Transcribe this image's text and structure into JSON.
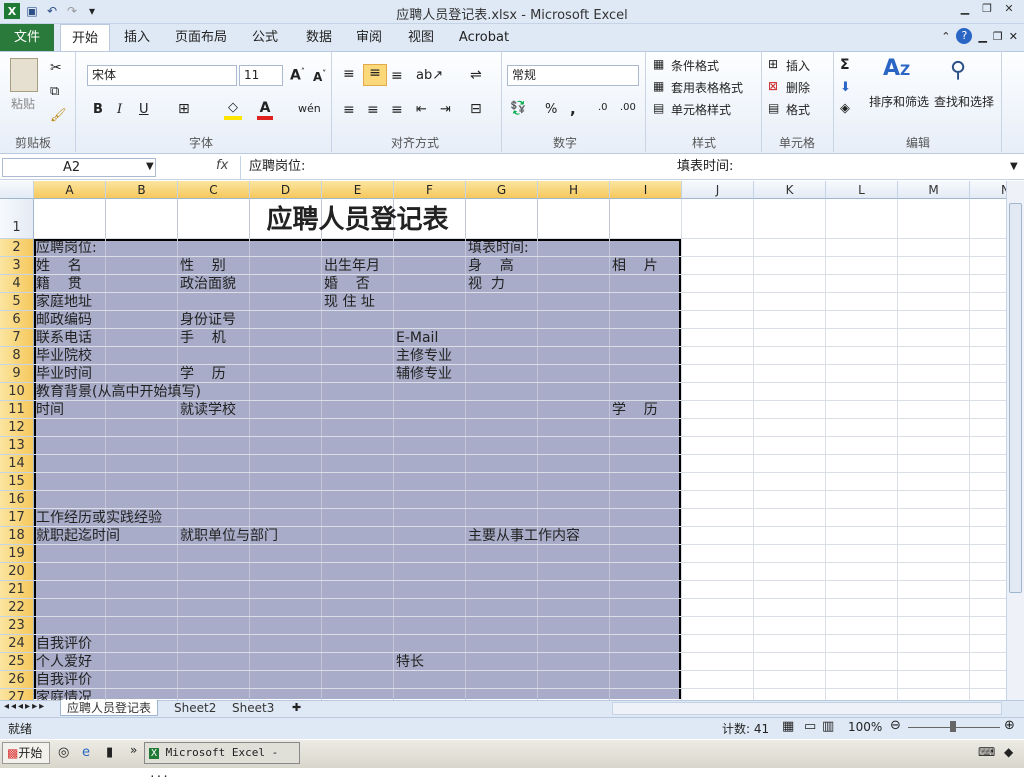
{
  "window": {
    "title": "应聘人员登记表.xlsx - Microsoft Excel"
  },
  "ribbon": {
    "file_tab": "文件",
    "tabs": [
      "开始",
      "插入",
      "页面布局",
      "公式",
      "数据",
      "审阅",
      "视图",
      "Acrobat"
    ],
    "clipboard": {
      "paste": "粘贴",
      "label": "剪贴板"
    },
    "font": {
      "name": "宋体",
      "size": "11",
      "label": "字体"
    },
    "align": {
      "label": "对齐方式"
    },
    "number": {
      "format": "常规",
      "label": "数字"
    },
    "styles": {
      "cond": "条件格式",
      "table": "套用表格格式",
      "cell": "单元格样式",
      "label": "样式"
    },
    "cells": {
      "insert": "插入",
      "delete": "删除",
      "format": "格式",
      "label": "单元格"
    },
    "edit": {
      "sort": "排序和筛选",
      "find": "查找和选择",
      "label": "编辑"
    }
  },
  "formula_bar": {
    "name_box": "A2",
    "content": "应聘岗位:",
    "content2": "填表时间:"
  },
  "columns": [
    "A",
    "B",
    "C",
    "D",
    "E",
    "F",
    "G",
    "H",
    "I",
    "J",
    "K",
    "L",
    "M",
    "N"
  ],
  "rows": [
    "1",
    "2",
    "3",
    "4",
    "5",
    "6",
    "7",
    "8",
    "9",
    "10",
    "11",
    "12",
    "13",
    "14",
    "15",
    "16",
    "17",
    "18",
    "19",
    "20",
    "21",
    "22",
    "23",
    "24",
    "25",
    "26",
    "27"
  ],
  "sheet": {
    "title": "应聘人员登记表",
    "cells": [
      {
        "r": 2,
        "c": "A",
        "t": "应聘岗位:"
      },
      {
        "r": 2,
        "c": "G",
        "t": "填表时间:"
      },
      {
        "r": 3,
        "c": "A",
        "t": "姓    名"
      },
      {
        "r": 3,
        "c": "C",
        "t": "性    别"
      },
      {
        "r": 3,
        "c": "E",
        "t": "出生年月"
      },
      {
        "r": 3,
        "c": "G",
        "t": "身    高"
      },
      {
        "r": 3,
        "c": "I",
        "t": "相    片"
      },
      {
        "r": 4,
        "c": "A",
        "t": "籍    贯"
      },
      {
        "r": 4,
        "c": "C",
        "t": "政治面貌"
      },
      {
        "r": 4,
        "c": "E",
        "t": "婚    否"
      },
      {
        "r": 4,
        "c": "G",
        "t": "视  力"
      },
      {
        "r": 5,
        "c": "A",
        "t": "家庭地址"
      },
      {
        "r": 5,
        "c": "E",
        "t": "现 住 址"
      },
      {
        "r": 6,
        "c": "A",
        "t": "邮政编码"
      },
      {
        "r": 6,
        "c": "C",
        "t": "身份证号"
      },
      {
        "r": 7,
        "c": "A",
        "t": "联系电话"
      },
      {
        "r": 7,
        "c": "C",
        "t": "手    机"
      },
      {
        "r": 7,
        "c": "F",
        "t": "E-Mail"
      },
      {
        "r": 8,
        "c": "A",
        "t": "毕业院校"
      },
      {
        "r": 8,
        "c": "F",
        "t": "主修专业"
      },
      {
        "r": 9,
        "c": "A",
        "t": "毕业时间"
      },
      {
        "r": 9,
        "c": "C",
        "t": "学    历"
      },
      {
        "r": 9,
        "c": "F",
        "t": "辅修专业"
      },
      {
        "r": 10,
        "c": "A",
        "t": "教育背景(从高中开始填写)"
      },
      {
        "r": 11,
        "c": "A",
        "t": "时间"
      },
      {
        "r": 11,
        "c": "C",
        "t": "就读学校"
      },
      {
        "r": 11,
        "c": "I",
        "t": "学    历"
      },
      {
        "r": 17,
        "c": "A",
        "t": "工作经历或实践经验"
      },
      {
        "r": 18,
        "c": "A",
        "t": "就职起迄时间"
      },
      {
        "r": 18,
        "c": "C",
        "t": "就职单位与部门"
      },
      {
        "r": 18,
        "c": "G",
        "t": "主要从事工作内容"
      },
      {
        "r": 24,
        "c": "A",
        "t": "自我评价"
      },
      {
        "r": 25,
        "c": "A",
        "t": "个人爱好"
      },
      {
        "r": 25,
        "c": "F",
        "t": "特长"
      },
      {
        "r": 26,
        "c": "A",
        "t": "自我评价"
      },
      {
        "r": 27,
        "c": "A",
        "t": "家庭情况"
      }
    ]
  },
  "sheet_tabs": [
    "应聘人员登记表",
    "Sheet2",
    "Sheet3"
  ],
  "status": {
    "ready": "就绪",
    "count": "计数: 41",
    "zoom": "100%"
  },
  "taskbar": {
    "start": "开始",
    "task": "Microsoft Excel - ..."
  },
  "colors": {
    "selection": "#a8acc8",
    "file_tab": "#2a7b3b",
    "ribbon_bg": "#dfe9f5"
  }
}
